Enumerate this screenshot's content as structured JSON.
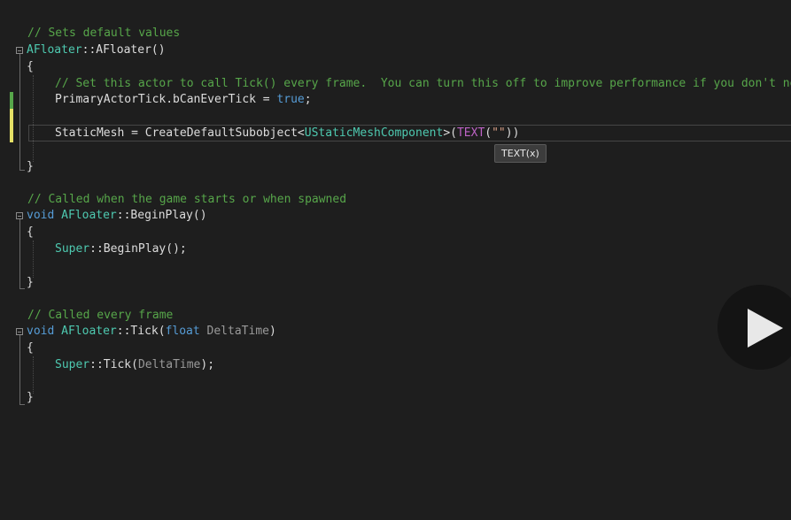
{
  "colors": {
    "background": "#1e1e1e",
    "comment": "#57a64a",
    "class_name": "#4ec9b0",
    "keyword": "#569cd6",
    "macro": "#bd63c5",
    "string": "#d69d85",
    "change_saved": "#57a64a",
    "change_unsaved": "#e5e066"
  },
  "editor": {
    "lines": [
      {
        "tokens": [
          {
            "c": "comment",
            "v": "// Sets default values"
          }
        ]
      },
      {
        "tokens": [
          {
            "c": "class",
            "v": "AFloater"
          },
          {
            "c": "text",
            "v": "::"
          },
          {
            "c": "func",
            "v": "AFloater"
          },
          {
            "c": "text",
            "v": "()"
          }
        ]
      },
      {
        "tokens": [
          {
            "c": "text",
            "v": "{"
          }
        ]
      },
      {
        "tokens": [
          {
            "c": "comment",
            "v": "// Set this actor to call Tick() every frame.  You can turn this off to improve performance if you don't need it."
          }
        ]
      },
      {
        "tokens": [
          {
            "c": "text",
            "v": "PrimaryActorTick.bCanEverTick = "
          },
          {
            "c": "kw",
            "v": "true"
          },
          {
            "c": "text",
            "v": ";"
          }
        ]
      },
      {
        "tokens": []
      },
      {
        "tokens": [
          {
            "c": "text",
            "v": "StaticMesh = CreateDefaultSubobject<"
          },
          {
            "c": "class",
            "v": "UStaticMeshComponent"
          },
          {
            "c": "text",
            "v": ">("
          },
          {
            "c": "macro",
            "v": "TEXT"
          },
          {
            "c": "text",
            "v": "("
          },
          {
            "c": "string",
            "v": "\"\""
          },
          {
            "c": "text",
            "v": "))"
          }
        ]
      },
      {
        "tokens": []
      },
      {
        "tokens": []
      },
      {
        "tokens": [
          {
            "c": "text",
            "v": "}"
          }
        ]
      },
      {
        "tokens": []
      },
      {
        "tokens": [
          {
            "c": "comment",
            "v": "// Called when the game starts or when spawned"
          }
        ]
      },
      {
        "tokens": [
          {
            "c": "kw",
            "v": "void"
          },
          {
            "c": "text",
            "v": " "
          },
          {
            "c": "class",
            "v": "AFloater"
          },
          {
            "c": "text",
            "v": "::"
          },
          {
            "c": "func",
            "v": "BeginPlay"
          },
          {
            "c": "text",
            "v": "()"
          }
        ]
      },
      {
        "tokens": [
          {
            "c": "text",
            "v": "{"
          }
        ]
      },
      {
        "tokens": [
          {
            "c": "class",
            "v": "Super"
          },
          {
            "c": "text",
            "v": "::"
          },
          {
            "c": "func",
            "v": "BeginPlay"
          },
          {
            "c": "text",
            "v": "();"
          }
        ]
      },
      {
        "tokens": []
      },
      {
        "tokens": [
          {
            "c": "text",
            "v": "}"
          }
        ]
      },
      {
        "tokens": []
      },
      {
        "tokens": [
          {
            "c": "comment",
            "v": "// Called every frame"
          }
        ]
      },
      {
        "tokens": [
          {
            "c": "kw",
            "v": "void"
          },
          {
            "c": "text",
            "v": " "
          },
          {
            "c": "class",
            "v": "AFloater"
          },
          {
            "c": "text",
            "v": "::"
          },
          {
            "c": "func",
            "v": "Tick"
          },
          {
            "c": "text",
            "v": "("
          },
          {
            "c": "kw",
            "v": "float"
          },
          {
            "c": "text",
            "v": " "
          },
          {
            "c": "param",
            "v": "DeltaTime"
          },
          {
            "c": "text",
            "v": ")"
          }
        ]
      },
      {
        "tokens": [
          {
            "c": "text",
            "v": "{"
          }
        ]
      },
      {
        "tokens": [
          {
            "c": "class",
            "v": "Super"
          },
          {
            "c": "text",
            "v": "::"
          },
          {
            "c": "func",
            "v": "Tick"
          },
          {
            "c": "text",
            "v": "("
          },
          {
            "c": "param",
            "v": "DeltaTime"
          },
          {
            "c": "text",
            "v": ");"
          }
        ]
      },
      {
        "tokens": []
      },
      {
        "tokens": [
          {
            "c": "text",
            "v": "}"
          }
        ]
      }
    ]
  },
  "tooltip": {
    "text": "TEXT(x)"
  },
  "video": {
    "play_icon": "play-icon"
  }
}
